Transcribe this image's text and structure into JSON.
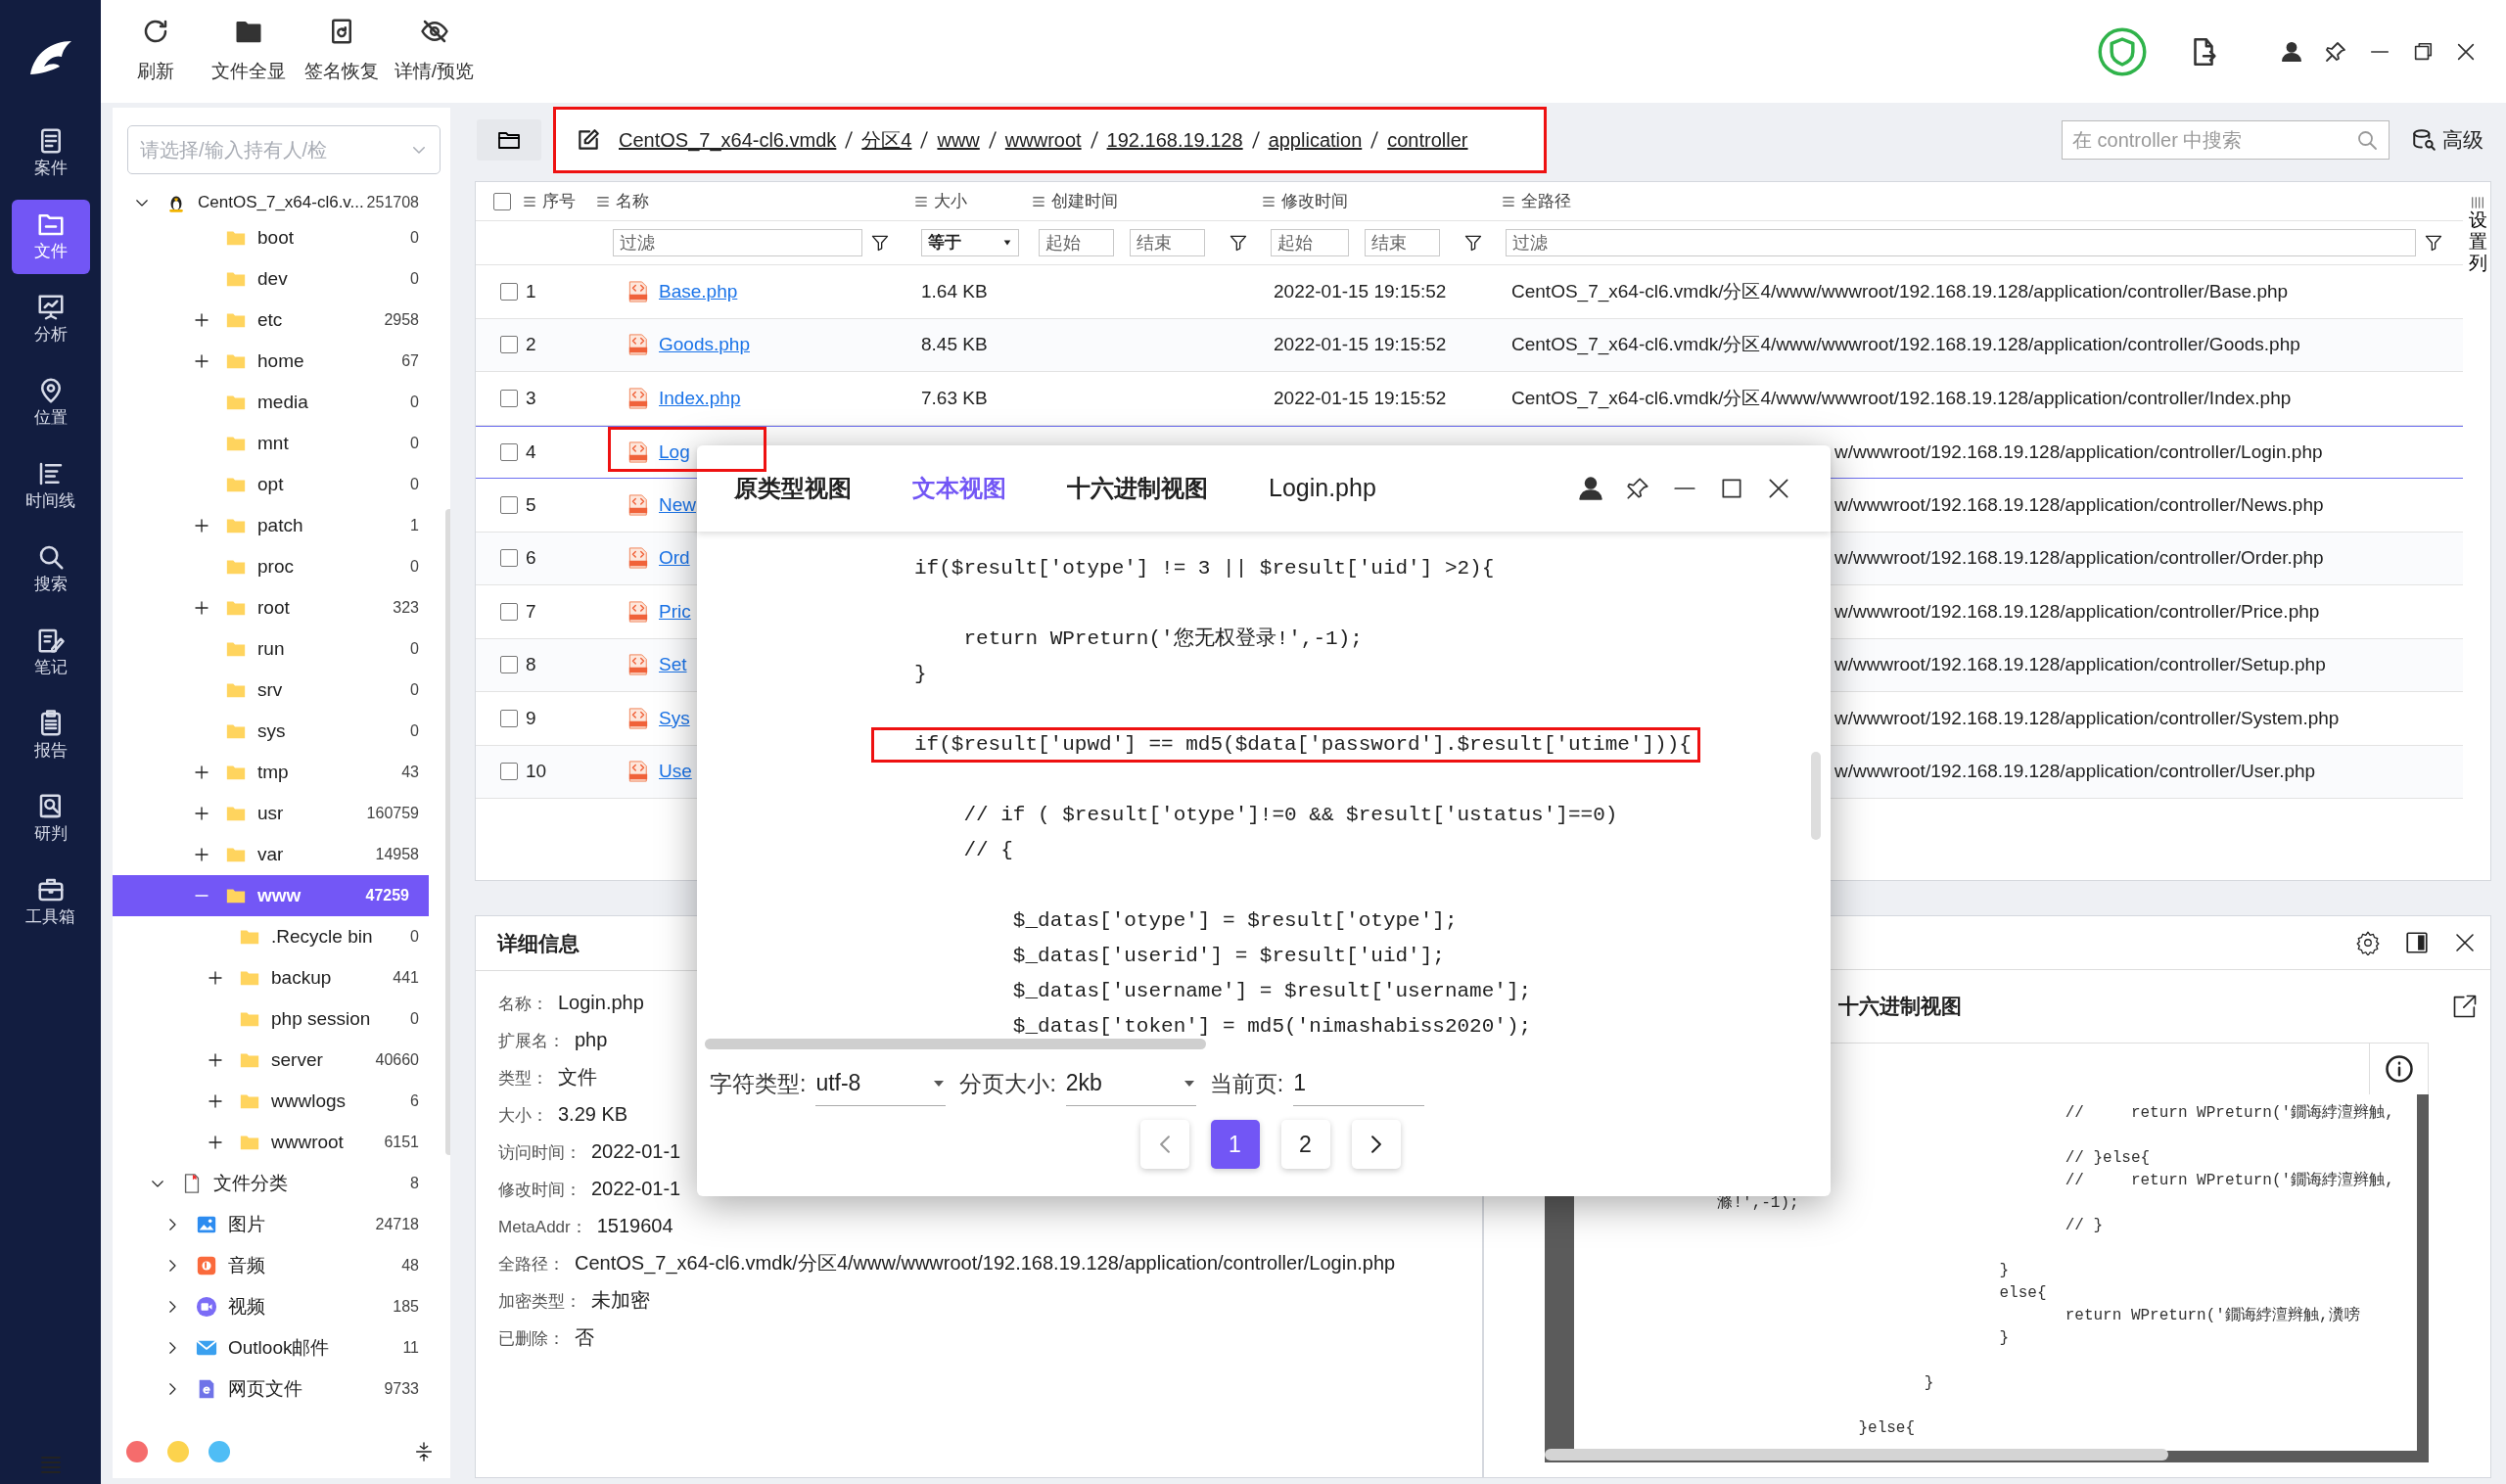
{
  "nav": {
    "items": [
      {
        "label": "案件",
        "selected": false
      },
      {
        "label": "文件",
        "selected": true
      },
      {
        "label": "分析",
        "selected": false
      },
      {
        "label": "位置",
        "selected": false
      },
      {
        "label": "时间线",
        "selected": false
      },
      {
        "label": "搜索",
        "selected": false
      },
      {
        "label": "笔记",
        "selected": false
      },
      {
        "label": "报告",
        "selected": false
      },
      {
        "label": "研判",
        "selected": false
      },
      {
        "label": "工具箱",
        "selected": false
      }
    ]
  },
  "toolbar": [
    {
      "label": "刷新",
      "kind": "refresh"
    },
    {
      "label": "文件全显",
      "kind": "folder"
    },
    {
      "label": "签名恢复",
      "kind": "restore"
    },
    {
      "label": "详情/预览",
      "kind": "hide"
    }
  ],
  "tree": {
    "placeholder": "请选择/输入持有人/检",
    "nodes": [
      {
        "label": "CentOS_7_x64-cl6.v...",
        "count": "251708",
        "kind": "disk",
        "expanded": true,
        "selected": false,
        "children": [
          {
            "label": "boot",
            "count": "0",
            "selected": false
          },
          {
            "label": "dev",
            "count": "0",
            "selected": false
          },
          {
            "label": "etc",
            "count": "2958",
            "expanded": false,
            "selected": false
          },
          {
            "label": "home",
            "count": "67",
            "expanded": false,
            "selected": false
          },
          {
            "label": "media",
            "count": "0",
            "selected": false
          },
          {
            "label": "mnt",
            "count": "0",
            "selected": false
          },
          {
            "label": "opt",
            "count": "0",
            "selected": false
          },
          {
            "label": "patch",
            "count": "1",
            "expanded": false,
            "selected": false
          },
          {
            "label": "proc",
            "count": "0",
            "selected": false
          },
          {
            "label": "root",
            "count": "323",
            "expanded": false,
            "selected": false
          },
          {
            "label": "run",
            "count": "0",
            "selected": false
          },
          {
            "label": "srv",
            "count": "0",
            "selected": false
          },
          {
            "label": "sys",
            "count": "0",
            "selected": false
          },
          {
            "label": "tmp",
            "count": "43",
            "expanded": false,
            "selected": false
          },
          {
            "label": "usr",
            "count": "160759",
            "expanded": false,
            "selected": false
          },
          {
            "label": "var",
            "count": "14958",
            "expanded": false,
            "selected": false
          },
          {
            "label": "www",
            "count": "47259",
            "expanded": true,
            "selected": true,
            "children": [
              {
                "label": ".Recycle bin",
                "count": "0",
                "selected": false
              },
              {
                "label": "backup",
                "count": "441",
                "expanded": false,
                "selected": false
              },
              {
                "label": "php session",
                "count": "0",
                "selected": false
              },
              {
                "label": "server",
                "count": "40660",
                "expanded": false,
                "selected": false
              },
              {
                "label": "wwwlogs",
                "count": "6",
                "expanded": false,
                "selected": false
              },
              {
                "label": "wwwroot",
                "count": "6151",
                "expanded": false,
                "selected": false
              }
            ]
          }
        ]
      },
      {
        "label": "文件分类",
        "count": "8",
        "kind": "category",
        "expanded": true,
        "selected": false,
        "children": [
          {
            "label": "图片",
            "count": "24718",
            "kind": "image",
            "expanded": false,
            "selected": false
          },
          {
            "label": "音频",
            "count": "48",
            "kind": "audio",
            "expanded": false,
            "selected": false
          },
          {
            "label": "视频",
            "count": "185",
            "kind": "video",
            "expanded": false,
            "selected": false
          },
          {
            "label": "Outlook邮件",
            "count": "11",
            "kind": "mail",
            "expanded": false,
            "selected": false
          },
          {
            "label": "网页文件",
            "count": "9733",
            "kind": "web",
            "expanded": false,
            "selected": false
          }
        ]
      }
    ],
    "color_tags": [
      {
        "color": "#f56c6c"
      },
      {
        "color": "#fcd34d"
      },
      {
        "color": "#4fbdf5"
      }
    ]
  },
  "breadcrumb": {
    "highlighted": true,
    "segments": [
      "CentOS_7_x64-cl6.vmdk",
      "分区4",
      "www",
      "wwwroot",
      "192.168.19.128",
      "application",
      "controller"
    ]
  },
  "search": {
    "placeholder": "在 controller 中搜索"
  },
  "advanced_label": "高级",
  "table": {
    "select_all": false,
    "columns": [
      "序号",
      "名称",
      "大小",
      "创建时间",
      "修改时间",
      "全路径"
    ],
    "filters": {
      "name": "过滤",
      "size": "等于",
      "created_from": "起始",
      "created_to": "结束",
      "modified_from": "起始",
      "modified_to": "结束",
      "path": "过滤"
    },
    "settings_label": "设置列",
    "rows": [
      {
        "no": "1",
        "name": "Base.php",
        "size": "1.64 KB",
        "modified": "2022-01-15 19:15:52",
        "path": "CentOS_7_x64-cl6.vmdk/分区4/www/wwwroot/192.168.19.128/application/controller/Base.php",
        "checked": false,
        "selected": false,
        "highlighted": false
      },
      {
        "no": "2",
        "name": "Goods.php",
        "size": "8.45 KB",
        "modified": "2022-01-15 19:15:52",
        "path": "CentOS_7_x64-cl6.vmdk/分区4/www/wwwroot/192.168.19.128/application/controller/Goods.php",
        "checked": false,
        "selected": false,
        "highlighted": false
      },
      {
        "no": "3",
        "name": "Index.php",
        "size": "7.63 KB",
        "modified": "2022-01-15 19:15:52",
        "path": "CentOS_7_x64-cl6.vmdk/分区4/www/wwwroot/192.168.19.128/application/controller/Index.php",
        "checked": false,
        "selected": false,
        "highlighted": false
      },
      {
        "no": "4",
        "name": "Log",
        "path": "w/wwwroot/192.168.19.128/application/controller/Login.php",
        "checked": false,
        "selected": true,
        "highlighted": true
      },
      {
        "no": "5",
        "name": "New",
        "path": "w/wwwroot/192.168.19.128/application/controller/News.php",
        "checked": false,
        "selected": false,
        "highlighted": false
      },
      {
        "no": "6",
        "name": "Ord",
        "path": "w/wwwroot/192.168.19.128/application/controller/Order.php",
        "checked": false,
        "selected": false,
        "highlighted": false
      },
      {
        "no": "7",
        "name": "Pric",
        "path": "w/wwwroot/192.168.19.128/application/controller/Price.php",
        "checked": false,
        "selected": false,
        "highlighted": false
      },
      {
        "no": "8",
        "name": "Set",
        "path": "w/wwwroot/192.168.19.128/application/controller/Setup.php",
        "checked": false,
        "selected": false,
        "highlighted": false
      },
      {
        "no": "9",
        "name": "Sys",
        "path": "w/wwwroot/192.168.19.128/application/controller/System.php",
        "checked": false,
        "selected": false,
        "highlighted": false
      },
      {
        "no": "10",
        "name": "Use",
        "path": "w/wwwroot/192.168.19.128/application/controller/User.php",
        "checked": false,
        "selected": false,
        "highlighted": false
      }
    ]
  },
  "details": {
    "title": "详细信息",
    "fields": [
      {
        "label": "名称：",
        "value": "Login.php"
      },
      {
        "label": "扩展名：",
        "value": "php"
      },
      {
        "label": "类型：",
        "value": "文件"
      },
      {
        "label": "大小：",
        "value": "3.29 KB"
      },
      {
        "label": "访问时间：",
        "value": "2022-01-1"
      },
      {
        "label": "修改时间：",
        "value": "2022-01-1"
      },
      {
        "label": "MetaAddr：",
        "value": "1519604"
      },
      {
        "label": "全路径：",
        "value": "CentOS_7_x64-cl6.vmdk/分区4/www/wwwroot/192.168.19.128/application/controller/Login.php"
      },
      {
        "label": "加密类型：",
        "value": "未加密"
      },
      {
        "label": "已删除：",
        "value": "否"
      }
    ]
  },
  "hex_panel": {
    "title": "十六进制视图",
    "code_blocks": [
      [
        "                                                   //     return WPreturn('鐗诲綍澶辫触,"
      ],
      [
        "                                                   // }else{",
        "                                                   //     return WPreturn('鐗诲綍澶辫触,",
        "              滌!',-1);",
        "                                                   // }"
      ],
      [
        "                                            }",
        "                                            else{",
        "                                                   return WPreturn('鐗诲綍澶辫触,瀵嗙",
        "                                            }"
      ],
      [
        "                                    }"
      ],
      [
        "                             }else{"
      ]
    ]
  },
  "viewer": {
    "tabs": [
      {
        "label": "原类型视图",
        "selected": false
      },
      {
        "label": "文本视图",
        "selected": true
      },
      {
        "label": "十六进制视图",
        "selected": false
      }
    ],
    "file_name": "Login.php",
    "code_blocks": [
      [
        {
          "text": "if($result['otype'] != 3 || $result['uid'] >2){",
          "highlighted": false
        }
      ],
      [
        {
          "text": "    return WPreturn('您无权登录!',-1);",
          "highlighted": false
        },
        {
          "text": "}",
          "highlighted": false
        }
      ],
      [
        {
          "text": "if($result['upwd'] == md5($data['password'].$result['utime'])){",
          "highlighted": true
        }
      ],
      [
        {
          "text": "    // if ( $result['otype']!=0 && $result['ustatus']==0)",
          "highlighted": false
        },
        {
          "text": "    // {",
          "highlighted": false
        }
      ],
      [
        {
          "text": "        $_datas['otype'] = $result['otype'];",
          "highlighted": false
        },
        {
          "text": "        $_datas['userid'] = $result['uid'];",
          "highlighted": false
        },
        {
          "text": "        $_datas['username'] = $result['username'];",
          "highlighted": false
        },
        {
          "text": "        $_datas['token'] = md5('nimashabiss2020');",
          "highlighted": false
        }
      ]
    ],
    "charset_label": "字符类型:",
    "charset": "utf-8",
    "page_size_label": "分页大小:",
    "page_size": "2kb",
    "page_label": "当前页:",
    "page": "1",
    "pages": [
      {
        "label": "1",
        "selected": true
      },
      {
        "label": "2",
        "selected": false
      }
    ]
  }
}
